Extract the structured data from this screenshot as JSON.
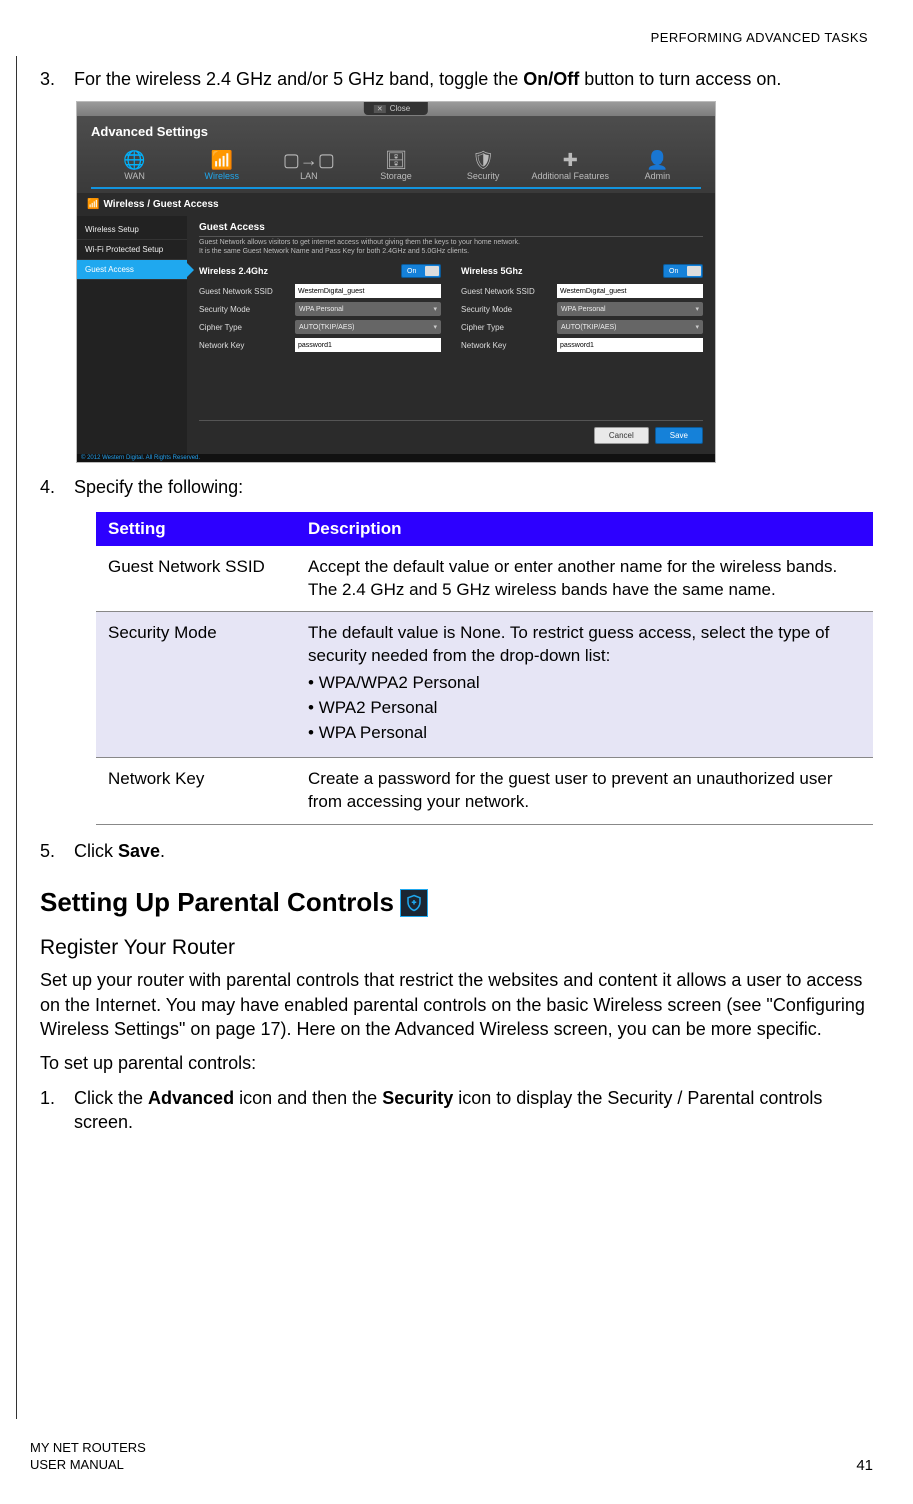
{
  "header_right": "PERFORMING ADVANCED TASKS",
  "steps": {
    "s3": {
      "num": "3.",
      "text_pre": "For the wireless 2.4 GHz and/or 5 GHz band, toggle the ",
      "bold": "On/Off",
      "text_post": " button to turn access on."
    },
    "s4": {
      "num": "4.",
      "text": "Specify the following:"
    },
    "s5": {
      "num": "5.",
      "text_pre": "Click ",
      "bold": "Save",
      "text_post": "."
    }
  },
  "uishot": {
    "close": "Close",
    "title": "Advanced Settings",
    "tabs": [
      "WAN",
      "Wireless",
      "LAN",
      "Storage",
      "Security",
      "Additional Features",
      "Admin"
    ],
    "active_tab": 1,
    "side_title": "Wireless / Guest Access",
    "side_items": [
      "Wireless Setup",
      "Wi-Fi Protected Setup",
      "Guest Access"
    ],
    "side_active": 2,
    "section_title": "Guest Access",
    "section_desc1": "Guest Network allows visitors to get internet access without giving them the keys to your home network.",
    "section_desc2": "It is the same Guest Network Name and Pass Key for both 2.4GHz and 5.0GHz clients.",
    "col24": "Wireless 2.4Ghz",
    "col5": "Wireless 5Ghz",
    "toggle_on": "On",
    "rows": {
      "ssid": {
        "label": "Guest Network SSID",
        "value": "WesternDigital_guest"
      },
      "security": {
        "label": "Security Mode",
        "value": "WPA Personal"
      },
      "cipher": {
        "label": "Cipher Type",
        "value": "AUTO(TKIP/AES)"
      },
      "key": {
        "label": "Network Key",
        "value": "password1"
      }
    },
    "cancel": "Cancel",
    "save": "Save",
    "copyright": "© 2012 Western Digital. All Rights Reserved."
  },
  "table": {
    "h1": "Setting",
    "h2": "Description",
    "rows": [
      {
        "setting": "Guest Network SSID",
        "desc": "Accept the default value or enter another name for the wireless bands. The 2.4 GHz and 5 GHz wireless bands have the same name.",
        "shade": false
      },
      {
        "setting": "Security Mode",
        "desc": "The default value is None. To restrict guess access, select the type of security needed from the drop-down list:",
        "bullets": [
          "WPA/WPA2 Personal",
          "WPA2 Personal",
          "WPA Personal"
        ],
        "shade": true
      },
      {
        "setting": "Network Key",
        "desc": "Create a password for the guest user to prevent an unauthorized user from accessing your network.",
        "shade": false
      }
    ]
  },
  "section_title": "Setting Up Parental Controls",
  "sub_title": "Register Your Router",
  "para1": "Set up your router with parental controls that restrict the websites and content it allows a user to access on the Internet. You may have enabled parental controls on the basic Wireless screen (see \"Configuring Wireless Settings\" on page 17). Here on the Advanced Wireless screen, you can be more specific.",
  "para2": "To set up parental controls:",
  "step_pc_1": {
    "num": "1.",
    "pre": "Click the ",
    "b1": "Advanced",
    "mid": " icon and then the ",
    "b2": "Security",
    "post": " icon to display the Security / Parental controls screen."
  },
  "footer_left1": "MY NET ROUTERS",
  "footer_left2": "USER MANUAL",
  "footer_right": "41"
}
